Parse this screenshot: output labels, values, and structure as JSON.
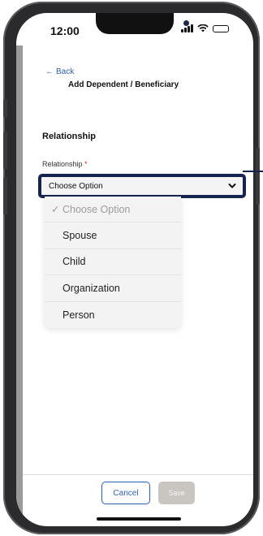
{
  "status_bar": {
    "time": "12:00",
    "icons": [
      "signal-icon",
      "wifi-icon",
      "battery-icon"
    ]
  },
  "header": {
    "back_label": "Back",
    "title": "Add Dependent / Beneficiary"
  },
  "section": {
    "title": "Relationship"
  },
  "field": {
    "label": "Relationship",
    "required_mark": "*",
    "value": "Choose Option"
  },
  "dropdown": {
    "check_mark": "✓",
    "options": [
      "Choose Option",
      "Spouse",
      "Child",
      "Organization",
      "Person"
    ],
    "selected_index": 0
  },
  "footer": {
    "cancel_label": "Cancel",
    "save_label": "Save"
  },
  "colors": {
    "accent": "#2f5fb3",
    "highlight_border": "#15254f",
    "required": "#c0392b",
    "disabled_button": "#c9c6c2"
  }
}
